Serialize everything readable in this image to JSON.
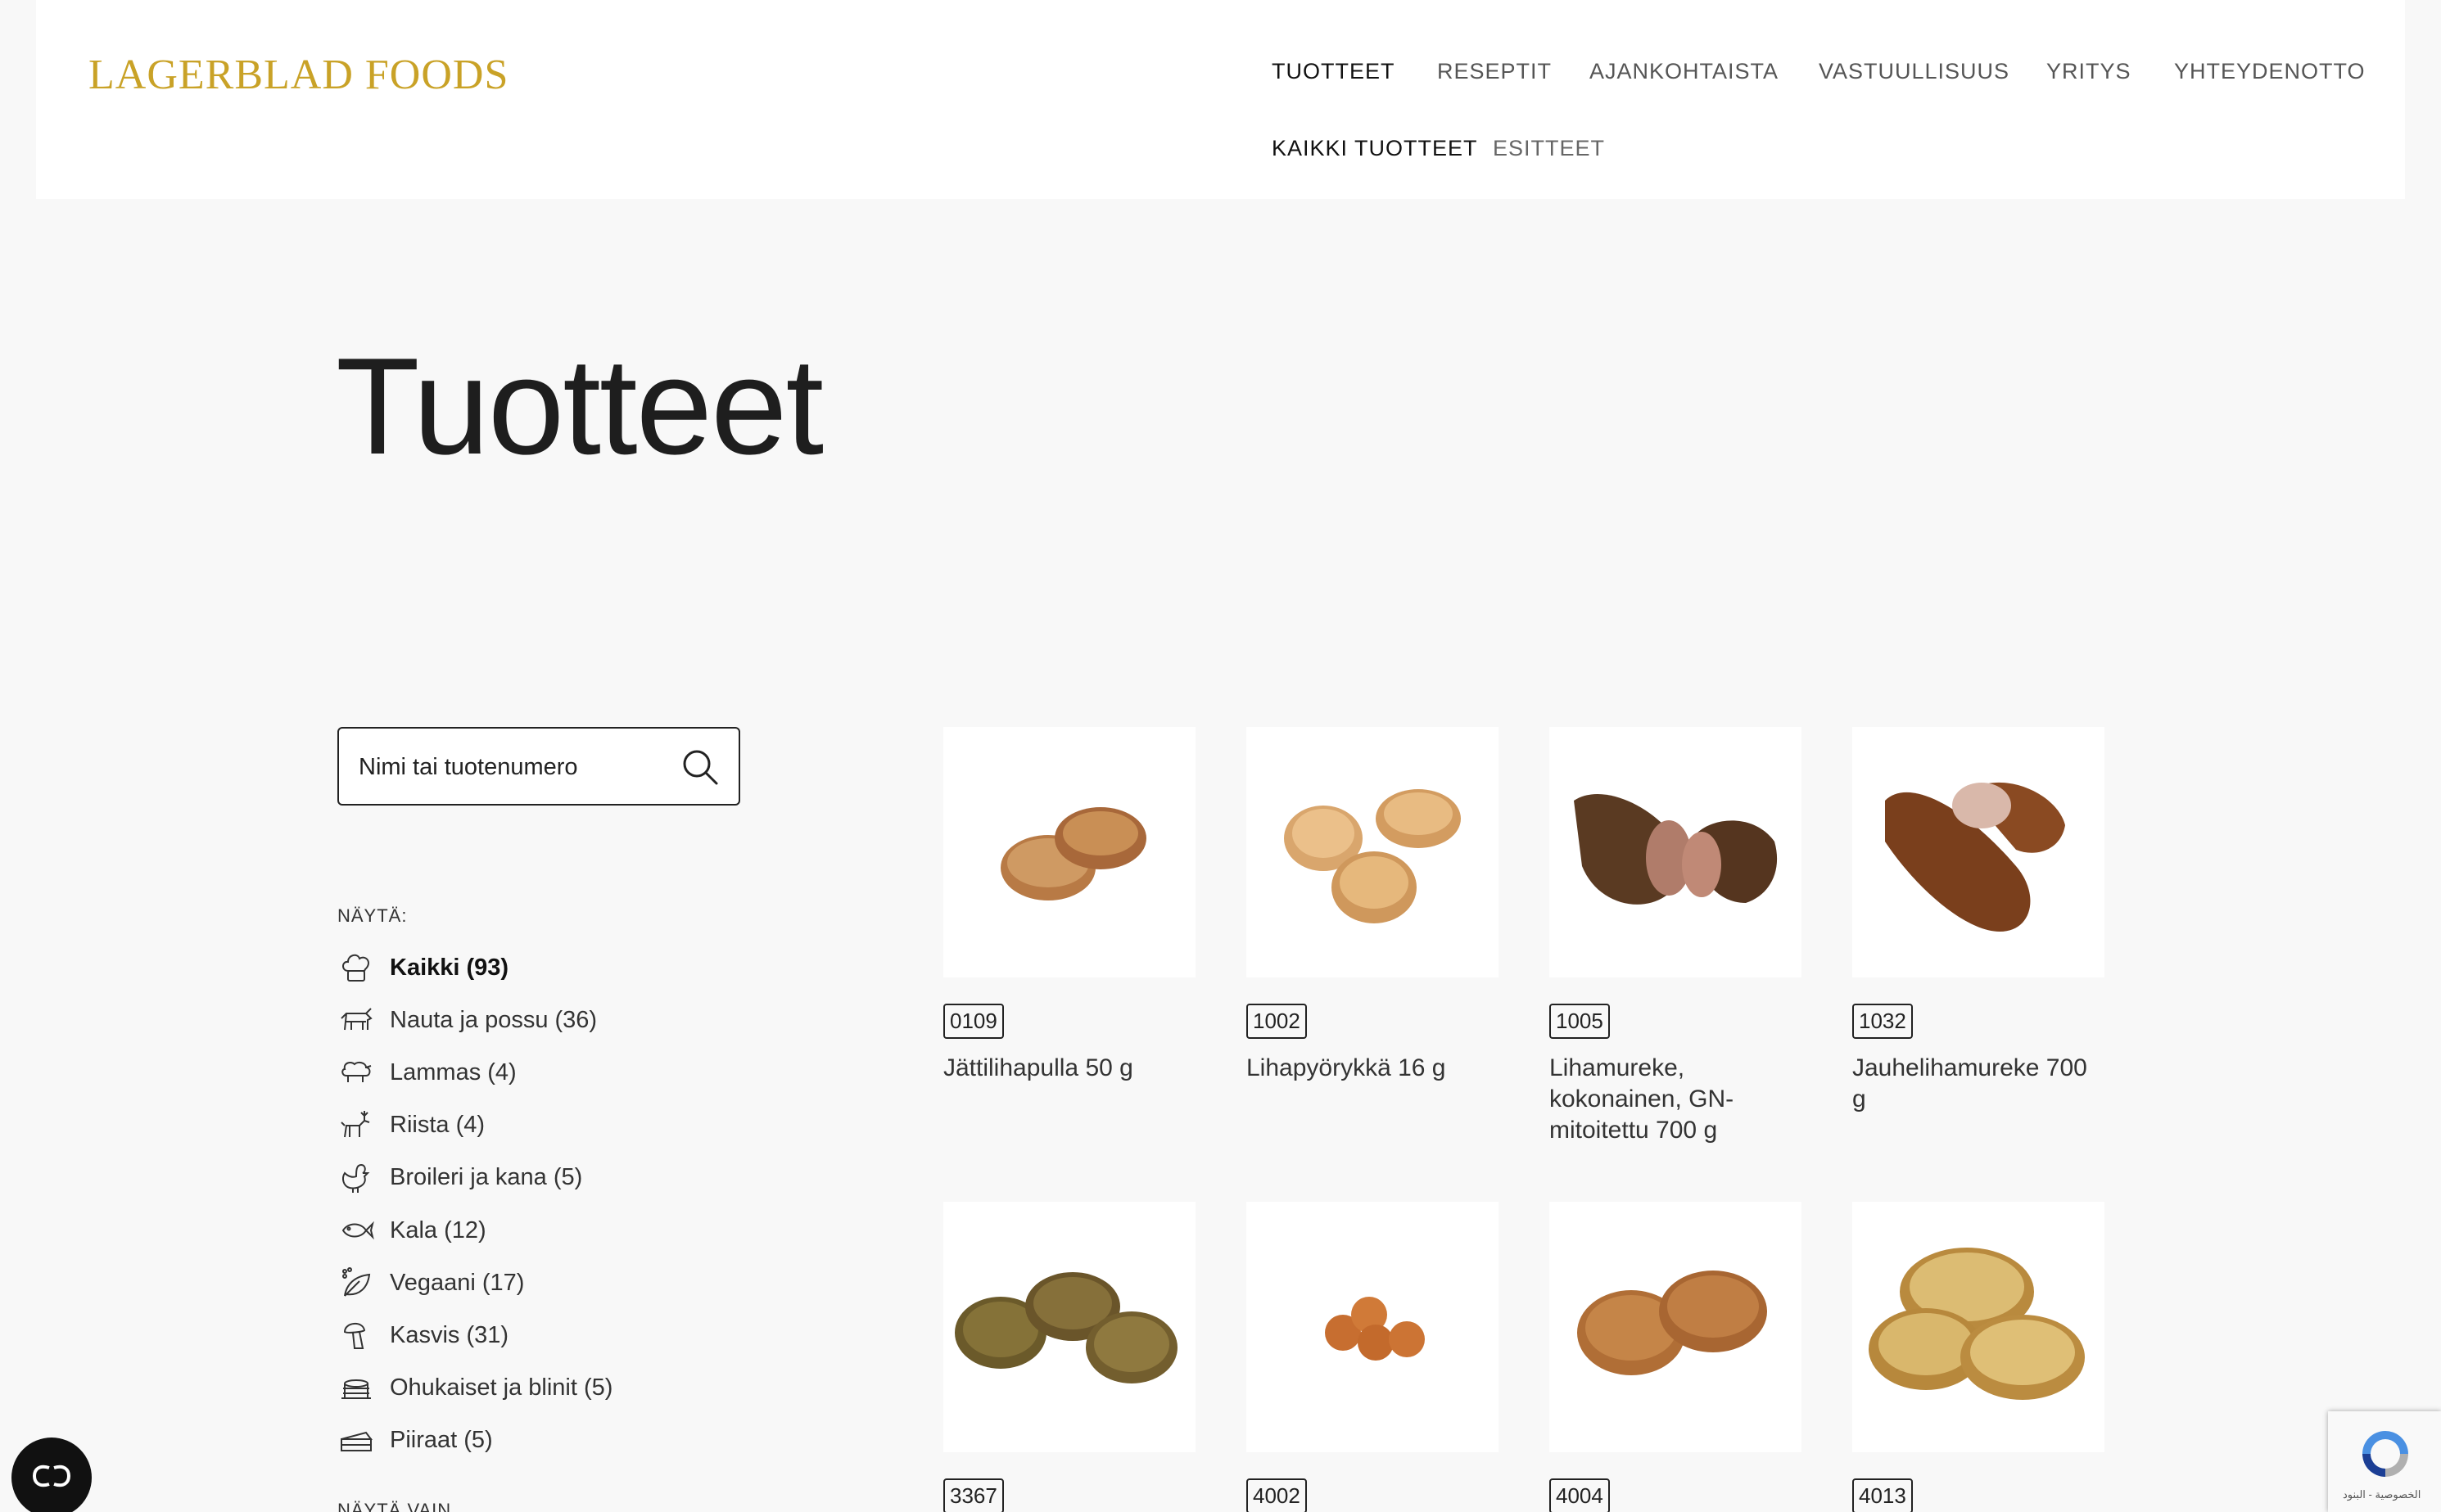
{
  "brand": {
    "logo_text": "LAGERBLAD FOODS",
    "accent_color": "#c9a227"
  },
  "nav": {
    "items": [
      {
        "label": "TUOTTEET",
        "active": true
      },
      {
        "label": "RESEPTIT"
      },
      {
        "label": "AJANKOHTAISTA"
      },
      {
        "label": "VASTUULLISUUS"
      },
      {
        "label": "YRITYS"
      },
      {
        "label": "YHTEYDENOTTO"
      }
    ],
    "sub_items": [
      {
        "label": "KAIKKI TUOTTEET",
        "active": true
      },
      {
        "label": "ESITTEET"
      }
    ]
  },
  "page": {
    "title": "Tuotteet"
  },
  "search": {
    "placeholder": "Nimi tai tuotenumero",
    "icon": "search-icon"
  },
  "filters": {
    "label": "NÄYTÄ:",
    "items": [
      {
        "label": "Kaikki (93)",
        "icon": "chef-hat-icon",
        "active": true
      },
      {
        "label": "Nauta ja possu (36)",
        "icon": "cow-icon"
      },
      {
        "label": "Lammas (4)",
        "icon": "sheep-icon"
      },
      {
        "label": "Riista (4)",
        "icon": "deer-icon"
      },
      {
        "label": "Broileri ja kana (5)",
        "icon": "chicken-icon"
      },
      {
        "label": "Kala (12)",
        "icon": "fish-icon"
      },
      {
        "label": "Vegaani (17)",
        "icon": "leaf-icon"
      },
      {
        "label": "Kasvis (31)",
        "icon": "mushroom-icon"
      },
      {
        "label": "Ohukaiset ja blinit (5)",
        "icon": "pancake-icon"
      },
      {
        "label": "Piiraat (5)",
        "icon": "pie-icon"
      }
    ],
    "label_2": "NÄYTÄ VAIN"
  },
  "products": [
    {
      "code": "0109",
      "name": "Jättilihapulla 50 g",
      "image": "meatball-icon"
    },
    {
      "code": "1002",
      "name": "Lihapyörykkä 16 g",
      "image": "meatball-icon"
    },
    {
      "code": "1005",
      "name": "Lihamureke, kokonainen, GN-mitoitettu 700 g",
      "image": "meatloaf-icon"
    },
    {
      "code": "1032",
      "name": "Jauhelihamureke 700 g",
      "image": "meatloaf-icon"
    },
    {
      "code": "3367",
      "name": "",
      "image": "patty-icon"
    },
    {
      "code": "4002",
      "name": "",
      "image": "meatball-icon"
    },
    {
      "code": "4004",
      "name": "",
      "image": "patty-icon"
    },
    {
      "code": "4013",
      "name": "",
      "image": "patty-icon"
    }
  ],
  "widgets": {
    "accessibility_icon": "accessibility-icon",
    "recaptcha_text": "الخصوصية - البنود"
  }
}
